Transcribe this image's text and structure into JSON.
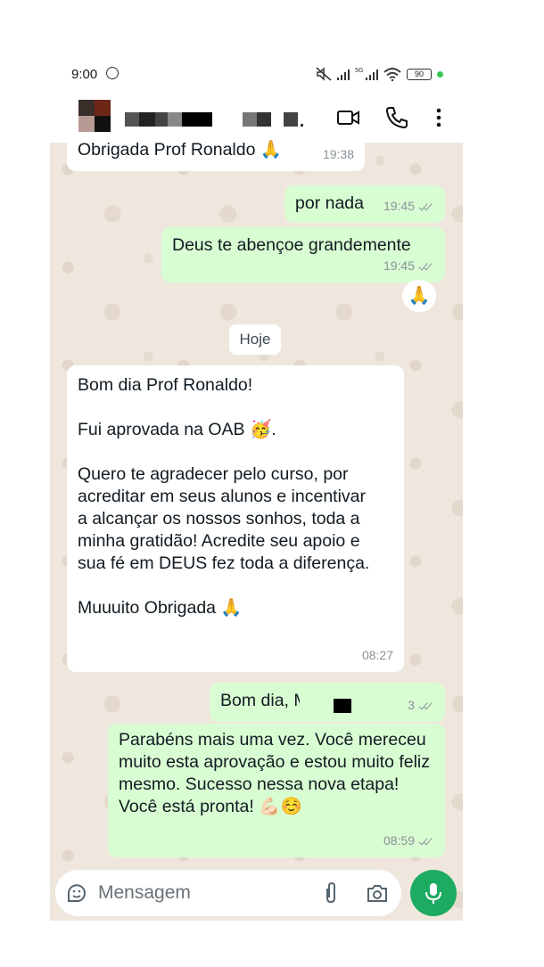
{
  "status_bar": {
    "time": "9:00",
    "net_label": "5G",
    "battery": "90"
  },
  "header": {
    "video_call": "video-call",
    "voice_call": "voice-call",
    "menu": "more-options"
  },
  "messages": [
    {
      "dir": "in",
      "text": "Obrigada Prof Ronaldo 🙏",
      "time": "19:38"
    },
    {
      "dir": "out",
      "text": "por nada",
      "time": "19:45"
    },
    {
      "dir": "out",
      "text": "Deus te abençoe grandemente",
      "time": "19:45",
      "reaction": "🙏"
    },
    {
      "dir": "in",
      "paragraphs": [
        "Bom dia Prof Ronaldo!",
        "Fui aprovada na OAB 🥳.",
        "Quero te agradecer pelo curso, por acreditar em seus alunos e incentivar a alcançar os nossos sonhos, toda a minha gratidão! Acredite seu apoio e sua fé em DEUS fez toda a diferença.",
        "Muuuito Obrigada 🙏"
      ],
      "time": "08:27"
    },
    {
      "dir": "out",
      "text": "Bom dia, M",
      "time": "3"
    },
    {
      "dir": "out",
      "text": "Parabéns mais uma vez. Você mereceu muito esta aprovação e estou muito feliz mesmo. Sucesso nessa nova etapa! Você está pronta! 💪🏻☺️",
      "time": "08:59"
    }
  ],
  "day_separator": "Hoje",
  "composer": {
    "placeholder": "Mensagem"
  },
  "colors": {
    "accent": "#1daa61",
    "bubble_out": "#d9fdd3",
    "bubble_in": "#ffffff",
    "chat_bg": "#efe7dd"
  }
}
